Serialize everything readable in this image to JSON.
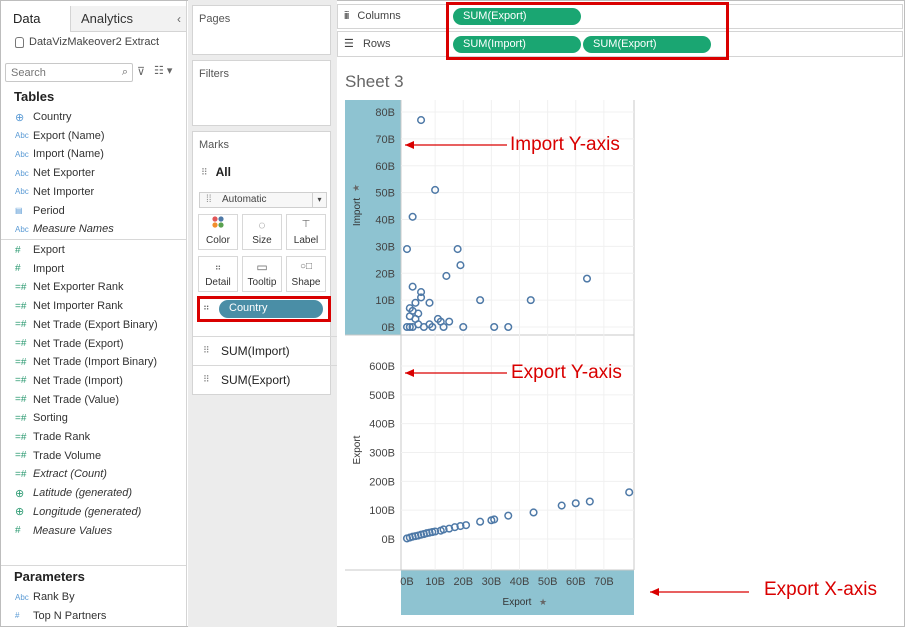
{
  "data_pane": {
    "tab_data": "Data",
    "tab_analytics": "Analytics",
    "collapse_icon": "chevron-left-icon",
    "datasource": "DataVizMakeover2 Extract",
    "search_placeholder": "Search",
    "tables_title": "Tables",
    "dimensions": [
      {
        "label": "Country",
        "icon": "⊕"
      },
      {
        "label": "Export (Name)",
        "icon": "Abc"
      },
      {
        "label": "Import (Name)",
        "icon": "Abc"
      },
      {
        "label": "Net Exporter",
        "icon": "Abc"
      },
      {
        "label": "Net Importer",
        "icon": "Abc"
      },
      {
        "label": "Period",
        "icon": "▤"
      },
      {
        "label": "Measure Names",
        "icon": "Abc"
      }
    ],
    "measures": [
      {
        "label": "Export",
        "icon": "#"
      },
      {
        "label": "Import",
        "icon": "#"
      },
      {
        "label": "Net Exporter Rank",
        "icon": "=#"
      },
      {
        "label": "Net Importer Rank",
        "icon": "=#"
      },
      {
        "label": "Net Trade (Export Binary)",
        "icon": "=#"
      },
      {
        "label": "Net Trade (Export)",
        "icon": "=#"
      },
      {
        "label": "Net Trade (Import Binary)",
        "icon": "=#"
      },
      {
        "label": "Net Trade (Import)",
        "icon": "=#"
      },
      {
        "label": "Net Trade (Value)",
        "icon": "=#"
      },
      {
        "label": "Sorting",
        "icon": "=#"
      },
      {
        "label": "Trade Rank",
        "icon": "=#"
      },
      {
        "label": "Trade Volume",
        "icon": "=#"
      },
      {
        "label": "Extract (Count)",
        "icon": "=#"
      },
      {
        "label": "Latitude (generated)",
        "icon": "⊕"
      },
      {
        "label": "Longitude (generated)",
        "icon": "⊕"
      },
      {
        "label": "Measure Values",
        "icon": "#"
      }
    ],
    "parameters_title": "Parameters",
    "parameters": [
      {
        "label": "Rank By",
        "icon": "Abc"
      },
      {
        "label": "Top N Partners",
        "icon": "#"
      }
    ]
  },
  "cards": {
    "pages": "Pages",
    "filters": "Filters",
    "marks": "Marks",
    "all": "All",
    "mark_type": "Automatic",
    "buttons": [
      {
        "label": "Color",
        "icon": "color-icon"
      },
      {
        "label": "Size",
        "icon": "size-icon"
      },
      {
        "label": "Label",
        "icon": "label-icon"
      },
      {
        "label": "Detail",
        "icon": "detail-icon"
      },
      {
        "label": "Tooltip",
        "icon": "tooltip-icon"
      },
      {
        "label": "Shape",
        "icon": "shape-icon"
      }
    ],
    "country_pill": "Country",
    "sum_import": "SUM(Import)",
    "sum_export": "SUM(Export)"
  },
  "shelves": {
    "columns_label": "Columns",
    "rows_label": "Rows",
    "column_pills": [
      "SUM(Export)"
    ],
    "row_pills": [
      "SUM(Import)",
      "SUM(Export)"
    ]
  },
  "sheet": {
    "title": "Sheet 3"
  },
  "annotations": {
    "import_y": "Import Y-axis",
    "export_y": "Export Y-axis",
    "export_x": "Export X-axis"
  },
  "colors": {
    "pill_green": "#1aa672",
    "pill_blue": "#4a8ea6",
    "axis_highlight": "#8ec3d1",
    "mark": "#4e79a7",
    "annotation_red": "#d90000"
  },
  "chart_data": [
    {
      "type": "scatter",
      "title": "",
      "xlabel": "Export",
      "ylabel": "Import",
      "x_ticks": [
        "0B",
        "10B",
        "20B",
        "30B",
        "40B",
        "50B",
        "60B",
        "70B"
      ],
      "y_ticks": [
        "0B",
        "10B",
        "20B",
        "30B",
        "40B",
        "50B",
        "60B",
        "70B",
        "80B"
      ],
      "xlim": [
        0,
        80
      ],
      "ylim": [
        0,
        80
      ],
      "grid": true,
      "points": [
        [
          5,
          77
        ],
        [
          10,
          51
        ],
        [
          2,
          41
        ],
        [
          0,
          29
        ],
        [
          18,
          29
        ],
        [
          19,
          23
        ],
        [
          14,
          19
        ],
        [
          44,
          10
        ],
        [
          26,
          10
        ],
        [
          64,
          18
        ],
        [
          2,
          15
        ],
        [
          5,
          13
        ],
        [
          5,
          11
        ],
        [
          3,
          9
        ],
        [
          8,
          9
        ],
        [
          1,
          7
        ],
        [
          2,
          6
        ],
        [
          4,
          5
        ],
        [
          1,
          4
        ],
        [
          3,
          3
        ],
        [
          11,
          3
        ],
        [
          12,
          2
        ],
        [
          15,
          2
        ],
        [
          8,
          1
        ],
        [
          13,
          0
        ],
        [
          20,
          0
        ],
        [
          31,
          0
        ],
        [
          36,
          0
        ],
        [
          0,
          0
        ],
        [
          1,
          0
        ],
        [
          2,
          0
        ],
        [
          4,
          1
        ],
        [
          6,
          0
        ],
        [
          9,
          0
        ]
      ]
    },
    {
      "type": "scatter",
      "title": "",
      "xlabel": "Export",
      "ylabel": "Export",
      "x_ticks": [
        "0B",
        "10B",
        "20B",
        "30B",
        "40B",
        "50B",
        "60B",
        "70B"
      ],
      "y_ticks": [
        "0B",
        "100B",
        "200B",
        "300B",
        "400B",
        "500B",
        "600B"
      ],
      "xlim": [
        0,
        80
      ],
      "ylim": [
        0,
        620
      ],
      "grid": true,
      "points": [
        [
          0,
          2
        ],
        [
          1,
          5
        ],
        [
          2,
          8
        ],
        [
          3,
          10
        ],
        [
          4,
          12
        ],
        [
          5,
          15
        ],
        [
          6,
          17
        ],
        [
          7,
          20
        ],
        [
          8,
          22
        ],
        [
          9,
          24
        ],
        [
          10,
          26
        ],
        [
          12,
          29
        ],
        [
          13,
          33
        ],
        [
          15,
          36
        ],
        [
          17,
          41
        ],
        [
          19,
          45
        ],
        [
          21,
          48
        ],
        [
          26,
          60
        ],
        [
          30,
          65
        ],
        [
          31,
          68
        ],
        [
          36,
          81
        ],
        [
          45,
          92
        ],
        [
          55,
          116
        ],
        [
          60,
          124
        ],
        [
          65,
          130
        ],
        [
          79,
          162
        ]
      ]
    }
  ]
}
